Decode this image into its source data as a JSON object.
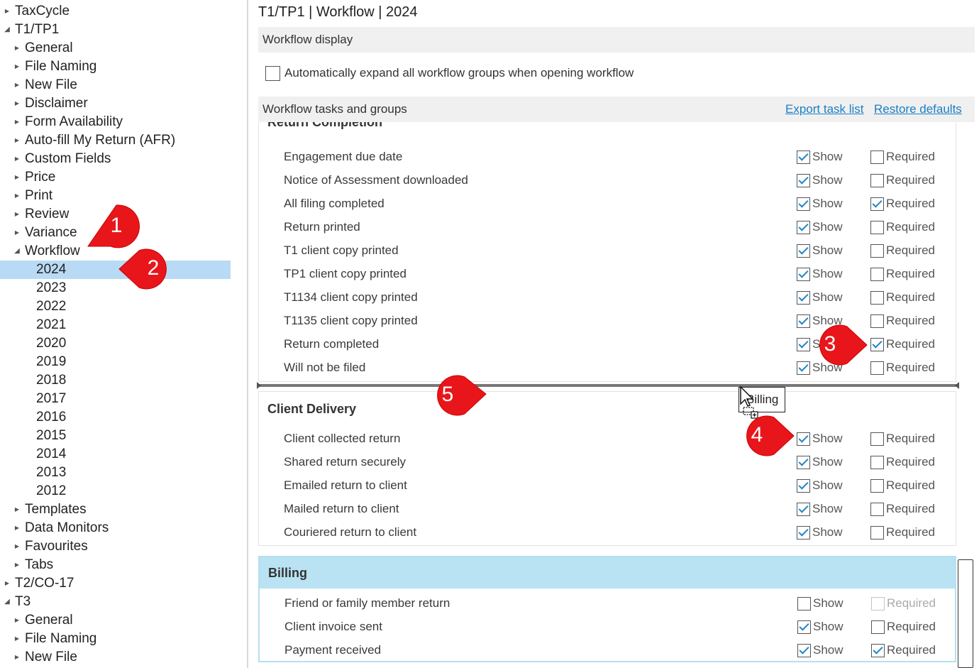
{
  "tree": {
    "items": [
      {
        "label": "TaxCycle",
        "state": "collapsed",
        "level": 0
      },
      {
        "label": "T1/TP1",
        "state": "expanded",
        "level": 0
      },
      {
        "label": "General",
        "state": "collapsed",
        "level": 1
      },
      {
        "label": "File Naming",
        "state": "collapsed",
        "level": 1
      },
      {
        "label": "New File",
        "state": "collapsed",
        "level": 1
      },
      {
        "label": "Disclaimer",
        "state": "collapsed",
        "level": 1
      },
      {
        "label": "Form Availability",
        "state": "collapsed",
        "level": 1
      },
      {
        "label": "Auto-fill My Return (AFR)",
        "state": "collapsed",
        "level": 1
      },
      {
        "label": "Custom Fields",
        "state": "collapsed",
        "level": 1
      },
      {
        "label": "Price",
        "state": "collapsed",
        "level": 1
      },
      {
        "label": "Print",
        "state": "collapsed",
        "level": 1
      },
      {
        "label": "Review",
        "state": "collapsed",
        "level": 1
      },
      {
        "label": "Variance",
        "state": "collapsed",
        "level": 1
      },
      {
        "label": "Workflow",
        "state": "expanded",
        "level": 1
      },
      {
        "label": "2024",
        "state": "leaf",
        "level": 2,
        "selected": true
      },
      {
        "label": "2023",
        "state": "leaf",
        "level": 2
      },
      {
        "label": "2022",
        "state": "leaf",
        "level": 2
      },
      {
        "label": "2021",
        "state": "leaf",
        "level": 2
      },
      {
        "label": "2020",
        "state": "leaf",
        "level": 2
      },
      {
        "label": "2019",
        "state": "leaf",
        "level": 2
      },
      {
        "label": "2018",
        "state": "leaf",
        "level": 2
      },
      {
        "label": "2017",
        "state": "leaf",
        "level": 2
      },
      {
        "label": "2016",
        "state": "leaf",
        "level": 2
      },
      {
        "label": "2015",
        "state": "leaf",
        "level": 2
      },
      {
        "label": "2014",
        "state": "leaf",
        "level": 2
      },
      {
        "label": "2013",
        "state": "leaf",
        "level": 2
      },
      {
        "label": "2012",
        "state": "leaf",
        "level": 2
      },
      {
        "label": "Templates",
        "state": "collapsed",
        "level": 1
      },
      {
        "label": "Data Monitors",
        "state": "collapsed",
        "level": 1
      },
      {
        "label": "Favourites",
        "state": "collapsed",
        "level": 1
      },
      {
        "label": "Tabs",
        "state": "collapsed",
        "level": 1
      },
      {
        "label": "T2/CO-17",
        "state": "collapsed",
        "level": 0
      },
      {
        "label": "T3",
        "state": "expanded",
        "level": 0
      },
      {
        "label": "General",
        "state": "collapsed",
        "level": 1
      },
      {
        "label": "File Naming",
        "state": "collapsed",
        "level": 1
      },
      {
        "label": "New File",
        "state": "collapsed",
        "level": 1
      }
    ]
  },
  "panel": {
    "title": "T1/TP1 | Workflow | 2024",
    "display_section": "Workflow display",
    "expand_label": "Automatically expand all workflow groups when opening workflow",
    "expand_checked": false,
    "tasks_section": "Workflow tasks and groups",
    "export_link": "Export task list",
    "restore_link": "Restore defaults",
    "show_label": "Show",
    "required_label": "Required"
  },
  "groups": [
    {
      "title": "Return Completion",
      "tasks": [
        {
          "label": "Engagement due date",
          "show": true,
          "required": false
        },
        {
          "label": "Notice of Assessment downloaded",
          "show": true,
          "required": false
        },
        {
          "label": "All filing completed",
          "show": true,
          "required": true
        },
        {
          "label": "Return printed",
          "show": true,
          "required": false
        },
        {
          "label": "T1 client copy printed",
          "show": true,
          "required": false
        },
        {
          "label": "TP1 client copy printed",
          "show": true,
          "required": false
        },
        {
          "label": "T1134 client copy printed",
          "show": true,
          "required": false
        },
        {
          "label": "T1135 client copy printed",
          "show": true,
          "required": false
        },
        {
          "label": "Return completed",
          "show": true,
          "required": true
        },
        {
          "label": "Will not be filed",
          "show": true,
          "required": false
        }
      ]
    },
    {
      "title": "Client Delivery",
      "tasks": [
        {
          "label": "Client collected return",
          "show": true,
          "required": false
        },
        {
          "label": "Shared return securely",
          "show": true,
          "required": false
        },
        {
          "label": "Emailed return to client",
          "show": true,
          "required": false
        },
        {
          "label": "Mailed return to client",
          "show": true,
          "required": false
        },
        {
          "label": "Couriered return to client",
          "show": true,
          "required": false
        }
      ]
    },
    {
      "title": "Billing",
      "tasks": [
        {
          "label": "Friend or family member return",
          "show": false,
          "required": false,
          "required_disabled": true
        },
        {
          "label": "Client invoice sent",
          "show": true,
          "required": false
        },
        {
          "label": "Payment received",
          "show": true,
          "required": true
        }
      ]
    }
  ],
  "drag_ghost": "Billing",
  "callouts": [
    "1",
    "2",
    "3",
    "4",
    "5"
  ],
  "colors": {
    "selection": "#b9daf4",
    "billing_header": "#b9e2f2",
    "link": "#1a7fc4",
    "check": "#1e86c8",
    "callout": "#e8161b"
  }
}
